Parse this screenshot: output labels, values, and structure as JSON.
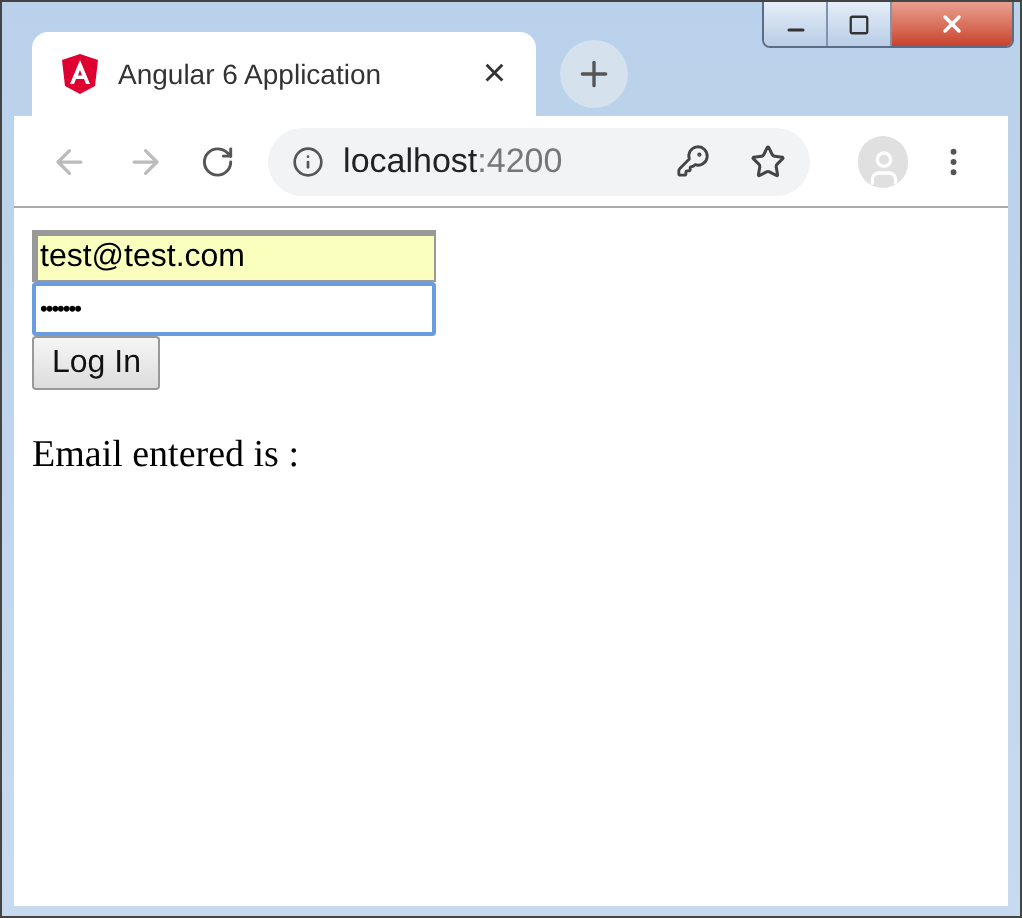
{
  "window": {
    "controls": [
      {
        "kind": "minimize"
      },
      {
        "kind": "maximize"
      },
      {
        "kind": "close"
      }
    ]
  },
  "tab": {
    "title": "Angular 6 Application",
    "close": "×"
  },
  "toolbar": {
    "url_host": "localhost",
    "url_port": ":4200"
  },
  "form": {
    "email": {
      "value": "test@test.com",
      "autofilled": true
    },
    "password": {
      "value": "•••••••",
      "focused": true
    },
    "button": "Log In"
  },
  "output": "Email entered is :"
}
